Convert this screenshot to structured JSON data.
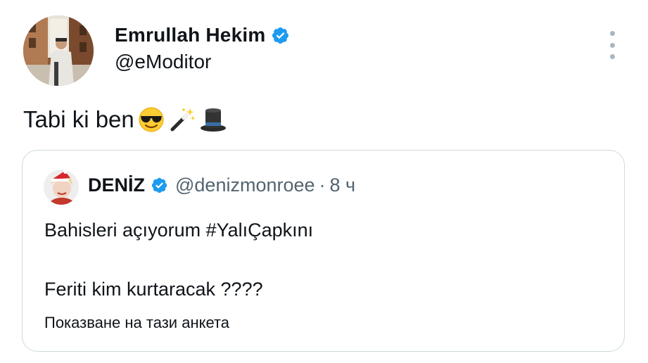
{
  "tweet": {
    "author": {
      "name": "Emrullah Hekim",
      "handle": "@eModitor",
      "verified": true
    },
    "text": "Tabi ki ben",
    "emojis": [
      "smiling-face-with-sunglasses",
      "magic-wand",
      "top-hat"
    ]
  },
  "quoted_tweet": {
    "author": {
      "name": "DENİZ",
      "handle": "@denizmonroee",
      "verified": true
    },
    "separator": "·",
    "time": "8 ч",
    "line1": "Bahisleri açıyorum #YalıÇapkını",
    "line2": "Feriti kim kurtaracak ????",
    "poll_link": "Показване на тази анкета"
  },
  "colors": {
    "verified_blue": "#1d9bf0",
    "text_primary": "#0f1419",
    "text_secondary": "#536471",
    "border": "#cfd9de",
    "menu_dots": "#a9b6c0"
  }
}
